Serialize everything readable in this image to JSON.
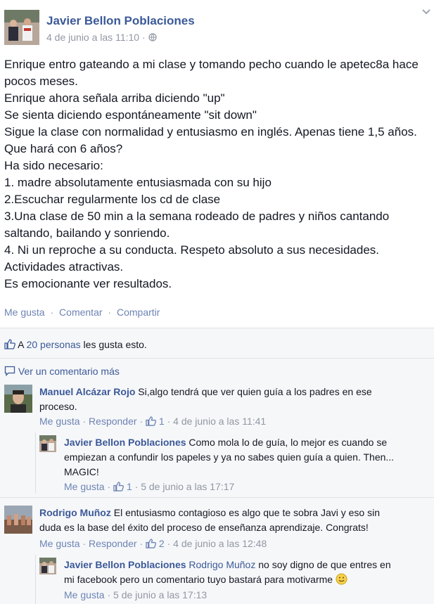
{
  "post": {
    "author": "Javier Bellon Poblaciones",
    "timestamp": "4 de junio a las 11:10",
    "privacy_icon": "globe-icon",
    "lines": [
      "Enrique entro gateando a mi clase y tomando pecho cuando le apetec8a hace",
      "pocos meses.",
      "Enrique ahora señala arriba diciendo \"up\"",
      "Se sienta diciendo espontáneamente \"sit down\"",
      "Sigue la clase con normalidad y entusiasmo en inglés. Apenas tiene 1,5 años.",
      "Que hará con 6 años?",
      "Ha sido necesario:",
      "1. madre absolutamente entusiasmada con su hijo",
      "2.Escuchar regularmente los cd de clase",
      "3.Una clase de 50 min a la semana rodeado de padres y niños cantando",
      "saltando, bailando y sonriendo.",
      "4. Ni un reproche a su conducta. Respeto absoluto a sus necesidades.",
      "Actividades atractivas.",
      "Es emocionante ver resultados."
    ],
    "actions": {
      "like": "Me gusta",
      "comment": "Comentar",
      "share": "Compartir",
      "sep": "·"
    }
  },
  "likes": {
    "prefix": "A ",
    "people": "20 personas",
    "suffix": " les gusta esto."
  },
  "view_more": "Ver un comentario más",
  "comments": [
    {
      "author": "Manuel Alcázar Rojo",
      "text_line1": "Si,algo tendrá que ver quien guía a los padres en ese",
      "text_line2": "proceso.",
      "like": "Me gusta",
      "reply": "Responder",
      "count": "1",
      "sep": "·",
      "time": "4 de junio a las 11:41"
    },
    {
      "author": "Javier Bellon Poblaciones",
      "text_line1": "Como mola lo de guía, lo mejor es cuando se",
      "text_line2": "empiezan a confundir los papeles y ya no sabes quien guía a quien. Then...",
      "text_line3": "MAGIC!",
      "like": "Me gusta",
      "count": "1",
      "sep": "·",
      "time": "5 de junio a las 17:17"
    },
    {
      "author": "Rodrigo Muñoz",
      "text_line1": "El entusiasmo contagioso es algo que te sobra Javi y eso sin",
      "text_line2": "duda es la base del éxito del proceso de enseñanza aprendizaje. Congrats!",
      "like": "Me gusta",
      "reply": "Responder",
      "count": "2",
      "sep": "·",
      "time": "4 de junio a las 12:48"
    },
    {
      "author": "Javier Bellon Poblaciones",
      "mention": "Rodrigo Muñoz",
      "text_line1": "no soy digno de que entres en",
      "text_line2": "mi facebook pero un comentario tuyo bastará para motivarme",
      "emoji": "smiley-emoji-icon",
      "like": "Me gusta",
      "sep": "·",
      "time": "5 de junio a las 17:13"
    }
  ],
  "colors": {
    "link": "#3b5998",
    "muted": "#9197a3",
    "action": "#6d84b4",
    "panel": "#f6f7f9"
  }
}
